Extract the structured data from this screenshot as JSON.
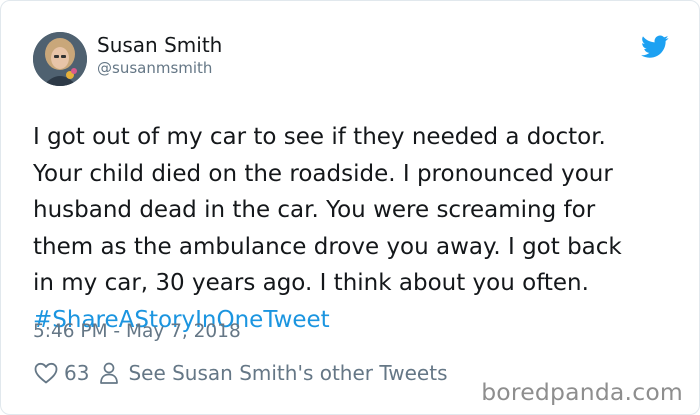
{
  "author": {
    "name": "Susan Smith",
    "handle": "@susanmsmith",
    "avatar_icon": "user-avatar-photo"
  },
  "brand": {
    "icon": "twitter-bird-icon",
    "color": "#1da1f2"
  },
  "tweet": {
    "lines": [
      "I got out of my car to see if they needed a doctor.",
      "Your child died on the roadside. I pronounced your",
      "husband dead in the car. You were screaming for",
      "them as the ambulance drove you away. I got back",
      "in my car, 30 years ago. I think about you often."
    ],
    "hashtag": "#ShareAStoryInOneTweet",
    "hashtag_color": "#1b95e0",
    "timestamp": "5:46 PM - May 7, 2018"
  },
  "actions": {
    "like_icon": "heart-icon",
    "like_count": "63",
    "profile_icon": "person-icon",
    "other_tweets_label": "See Susan Smith's other Tweets"
  },
  "watermark": {
    "text": "boredpanda.com"
  }
}
